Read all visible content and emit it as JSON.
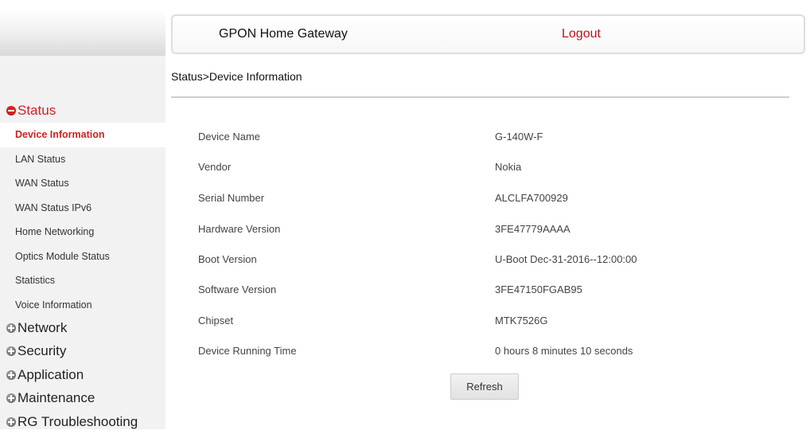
{
  "header": {
    "title": "GPON Home Gateway",
    "logout_label": "Logout"
  },
  "breadcrumb": "Status>Device Information",
  "sidebar": {
    "status_label": "Status",
    "status_items": [
      {
        "label": "Device Information",
        "active": true
      },
      {
        "label": "LAN Status"
      },
      {
        "label": "WAN Status"
      },
      {
        "label": "WAN Status IPv6"
      },
      {
        "label": "Home Networking"
      },
      {
        "label": "Optics Module Status"
      },
      {
        "label": "Statistics"
      },
      {
        "label": "Voice Information"
      }
    ],
    "groups": [
      {
        "label": "Network"
      },
      {
        "label": "Security"
      },
      {
        "label": "Application"
      },
      {
        "label": "Maintenance"
      },
      {
        "label": "RG Troubleshooting"
      }
    ]
  },
  "device_info": [
    {
      "label": "Device Name",
      "value": "G-140W-F"
    },
    {
      "label": "Vendor",
      "value": "Nokia"
    },
    {
      "label": "Serial Number",
      "value": "ALCLFA700929"
    },
    {
      "label": "Hardware Version",
      "value": "3FE47779AAAA"
    },
    {
      "label": "Boot Version",
      "value": "U-Boot Dec-31-2016--12:00:00"
    },
    {
      "label": "Software Version",
      "value": "3FE47150FGAB95"
    },
    {
      "label": "Chipset",
      "value": "MTK7526G"
    },
    {
      "label": "Device Running Time",
      "value": "0 hours 8 minutes 10 seconds"
    }
  ],
  "refresh_label": "Refresh",
  "colors": {
    "accent_red": "#cc2222",
    "logout_red": "#b8141c",
    "sidebar_bg": "#f2f2f2"
  }
}
